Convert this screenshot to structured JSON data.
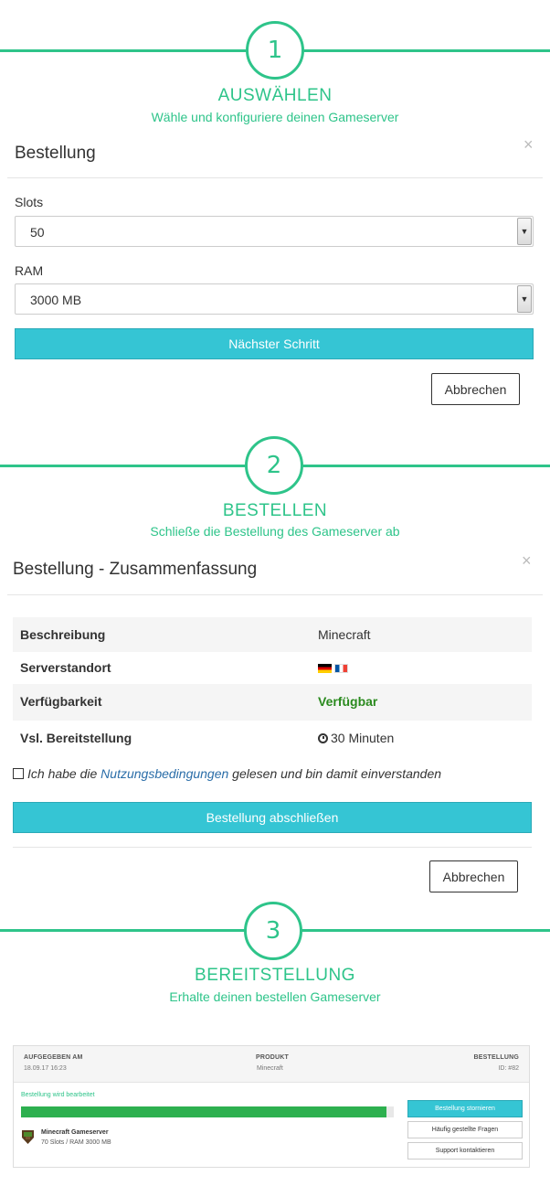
{
  "steps": [
    {
      "number": "1",
      "title": "AUSWÄHLEN",
      "subtitle": "Wähle und konfiguriere deinen Gameserver"
    },
    {
      "number": "2",
      "title": "BESTELLEN",
      "subtitle": "Schließe die Bestellung des Gameserver ab"
    },
    {
      "number": "3",
      "title": "BEREITSTELLUNG",
      "subtitle": "Erhalte deinen bestellen Gameserver"
    }
  ],
  "order_form": {
    "title": "Bestellung",
    "close": "×",
    "slots_label": "Slots",
    "slots_value": "50",
    "ram_label": "RAM",
    "ram_value": "3000 MB",
    "next_button": "Nächster Schritt",
    "cancel_button": "Abbrechen"
  },
  "summary": {
    "title": "Bestellung - Zusammenfassung",
    "close": "×",
    "rows": [
      {
        "key": "Beschreibung",
        "value": "Minecraft"
      },
      {
        "key": "Serverstandort",
        "value": ""
      },
      {
        "key": "Verfügbarkeit",
        "value": "Verfügbar"
      },
      {
        "key": "Vsl. Bereitstellung",
        "value": "30 Minuten"
      }
    ],
    "location_flags": [
      "flag-de-icon",
      "flag-fr-icon"
    ],
    "availability_color": "#2a8a1e",
    "terms_before": "Ich habe die ",
    "terms_link": "Nutzungsbedingungen",
    "terms_after": " gelesen und bin damit einverstanden",
    "terms_checked": false,
    "submit_button": "Bestellung abschließen",
    "cancel_button": "Abbrechen"
  },
  "order_card": {
    "placed_label": "AUFGEGEBEN AM",
    "placed_value": "18.09.17 16:23",
    "product_label": "PRODUKT",
    "product_value": "Minecraft",
    "order_label": "BESTELLUNG",
    "order_value": "ID: #82",
    "status": "Bestellung wird bearbeitet",
    "progress": 0.98,
    "game_name": "Minecraft Gameserver",
    "game_desc": "70 Slots / RAM 3000 MB",
    "cancel_order_button": "Bestellung stornieren",
    "faq_button": "Häufig gestellte Fragen",
    "support_button": "Support kontaktieren"
  },
  "colors": {
    "accent_green": "#2ec48a",
    "button_cyan": "#35c5d4",
    "progress_green": "#2db04f",
    "link_blue": "#2a6da8"
  }
}
